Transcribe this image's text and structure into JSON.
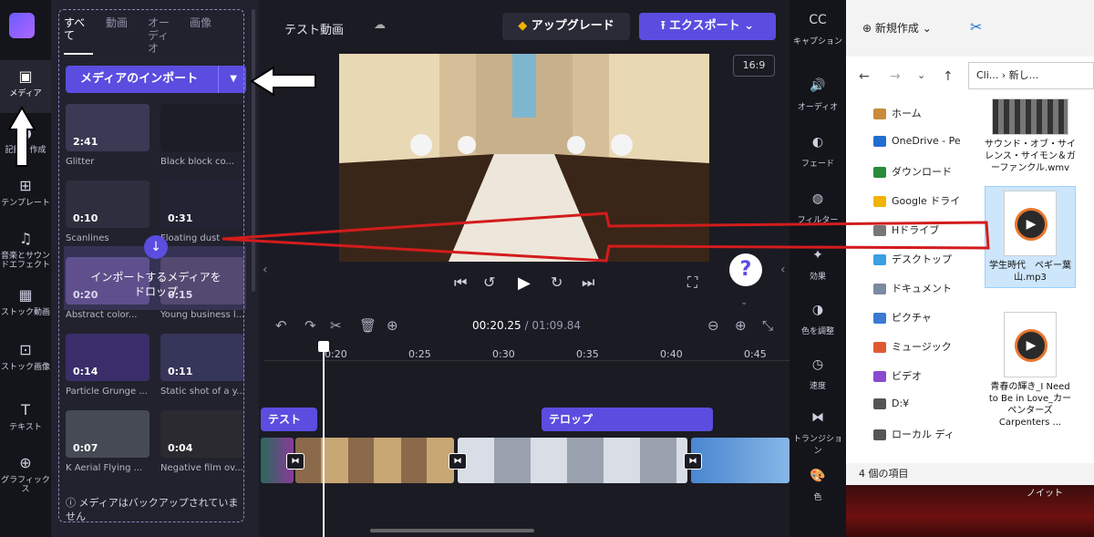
{
  "nav": {
    "items": [
      {
        "label": "メディア",
        "icon": "folder-icon"
      },
      {
        "label": "記録と作成",
        "icon": "record-icon"
      },
      {
        "label": "テンプレート",
        "icon": "template-icon"
      },
      {
        "label": "音楽とサウンドエフェクト",
        "icon": "music-icon"
      },
      {
        "label": "ストック動画",
        "icon": "stock-video-icon"
      },
      {
        "label": "ストック画像",
        "icon": "stock-image-icon"
      },
      {
        "label": "テキスト",
        "icon": "text-icon"
      },
      {
        "label": "グラフィックス",
        "icon": "graphics-icon"
      }
    ]
  },
  "panel": {
    "tabs": [
      "すべて",
      "動画",
      "オーディオ",
      "画像"
    ],
    "import_label": "メディアのインポート",
    "drop_text": "インポートするメディアをドロップ",
    "backup_text": "メディアはバックアップされていません",
    "media": [
      {
        "duration": "2:41",
        "name": "Glitter",
        "color": "#3a3a55"
      },
      {
        "duration": "",
        "name": "Black block co...",
        "color": "#1d1d28"
      },
      {
        "duration": "0:10",
        "name": "Scanlines",
        "color": "#2e2e3e"
      },
      {
        "duration": "0:31",
        "name": "Floating dust",
        "color": "#232333"
      },
      {
        "duration": "0:20",
        "name": "Abstract color...",
        "color": "#5a4a7a"
      },
      {
        "duration": "0:15",
        "name": "Young business l...",
        "color": "#4a4055"
      },
      {
        "duration": "0:14",
        "name": "Particle Grunge ...",
        "color": "#3a2e6a"
      },
      {
        "duration": "0:11",
        "name": "Static shot of a y...",
        "color": "#36355a"
      },
      {
        "duration": "0:07",
        "name": "K Aerial Flying ...",
        "color": "#454a55"
      },
      {
        "duration": "0:04",
        "name": "Negative film ov...",
        "color": "#2a2a30"
      }
    ]
  },
  "header": {
    "project_title": "テスト動画",
    "upgrade_label": "アップグレード",
    "export_label": "エクスポート",
    "aspect": "16:9"
  },
  "timeline": {
    "current_time": "00:20.25",
    "total_time": "/ 01:09.84",
    "ticks": [
      "0:20",
      "0:25",
      "0:30",
      "0:35",
      "0:40",
      "0:45"
    ],
    "text_clips": [
      "テスト",
      "テロップ"
    ]
  },
  "props": {
    "items": [
      {
        "label": "キャプション",
        "icon": "captions-icon"
      },
      {
        "label": "オーディオ",
        "icon": "audio-icon"
      },
      {
        "label": "フェード",
        "icon": "fade-icon"
      },
      {
        "label": "フィルター",
        "icon": "filter-icon"
      },
      {
        "label": "効果",
        "icon": "effects-icon"
      },
      {
        "label": "色を調整",
        "icon": "color-adjust-icon"
      },
      {
        "label": "速度",
        "icon": "speed-icon"
      },
      {
        "label": "トランジション",
        "icon": "transition-icon"
      },
      {
        "label": "色",
        "icon": "palette-icon"
      }
    ]
  },
  "explorer": {
    "new_label": "新規作成",
    "path": "Cli... › 新し...",
    "tree": [
      {
        "label": "ホーム",
        "color": "#c98a3a"
      },
      {
        "label": "OneDrive - Pe",
        "color": "#1f6fd0"
      },
      {
        "label": "ダウンロード",
        "color": "#2a8a3a"
      },
      {
        "label": "Google ドライ",
        "color": "#f2b400"
      },
      {
        "label": "Hドライブ",
        "color": "#777777"
      },
      {
        "label": "デスクトップ",
        "color": "#3aa0e0"
      },
      {
        "label": "ドキュメント",
        "color": "#7a8aa0"
      },
      {
        "label": "ピクチャ",
        "color": "#3a7ad0"
      },
      {
        "label": "ミュージック",
        "color": "#e05a30"
      },
      {
        "label": "ビデオ",
        "color": "#8a4ad0"
      },
      {
        "label": "D:¥",
        "color": "#555555"
      },
      {
        "label": "ローカル ディ",
        "color": "#555555"
      }
    ],
    "files": [
      {
        "name": "サウンド・オブ・サイレンス・サイモン＆ガーファンクル.wmv",
        "type": "video"
      },
      {
        "name": "学生時代　ペギー葉山.mp3",
        "type": "audio"
      },
      {
        "name": "青春の輝き_I Need to Be in Love_カーペンターズ Carpenters ...",
        "type": "audio"
      }
    ],
    "status": "4 個の項目",
    "desktop_label": "ノイット"
  }
}
